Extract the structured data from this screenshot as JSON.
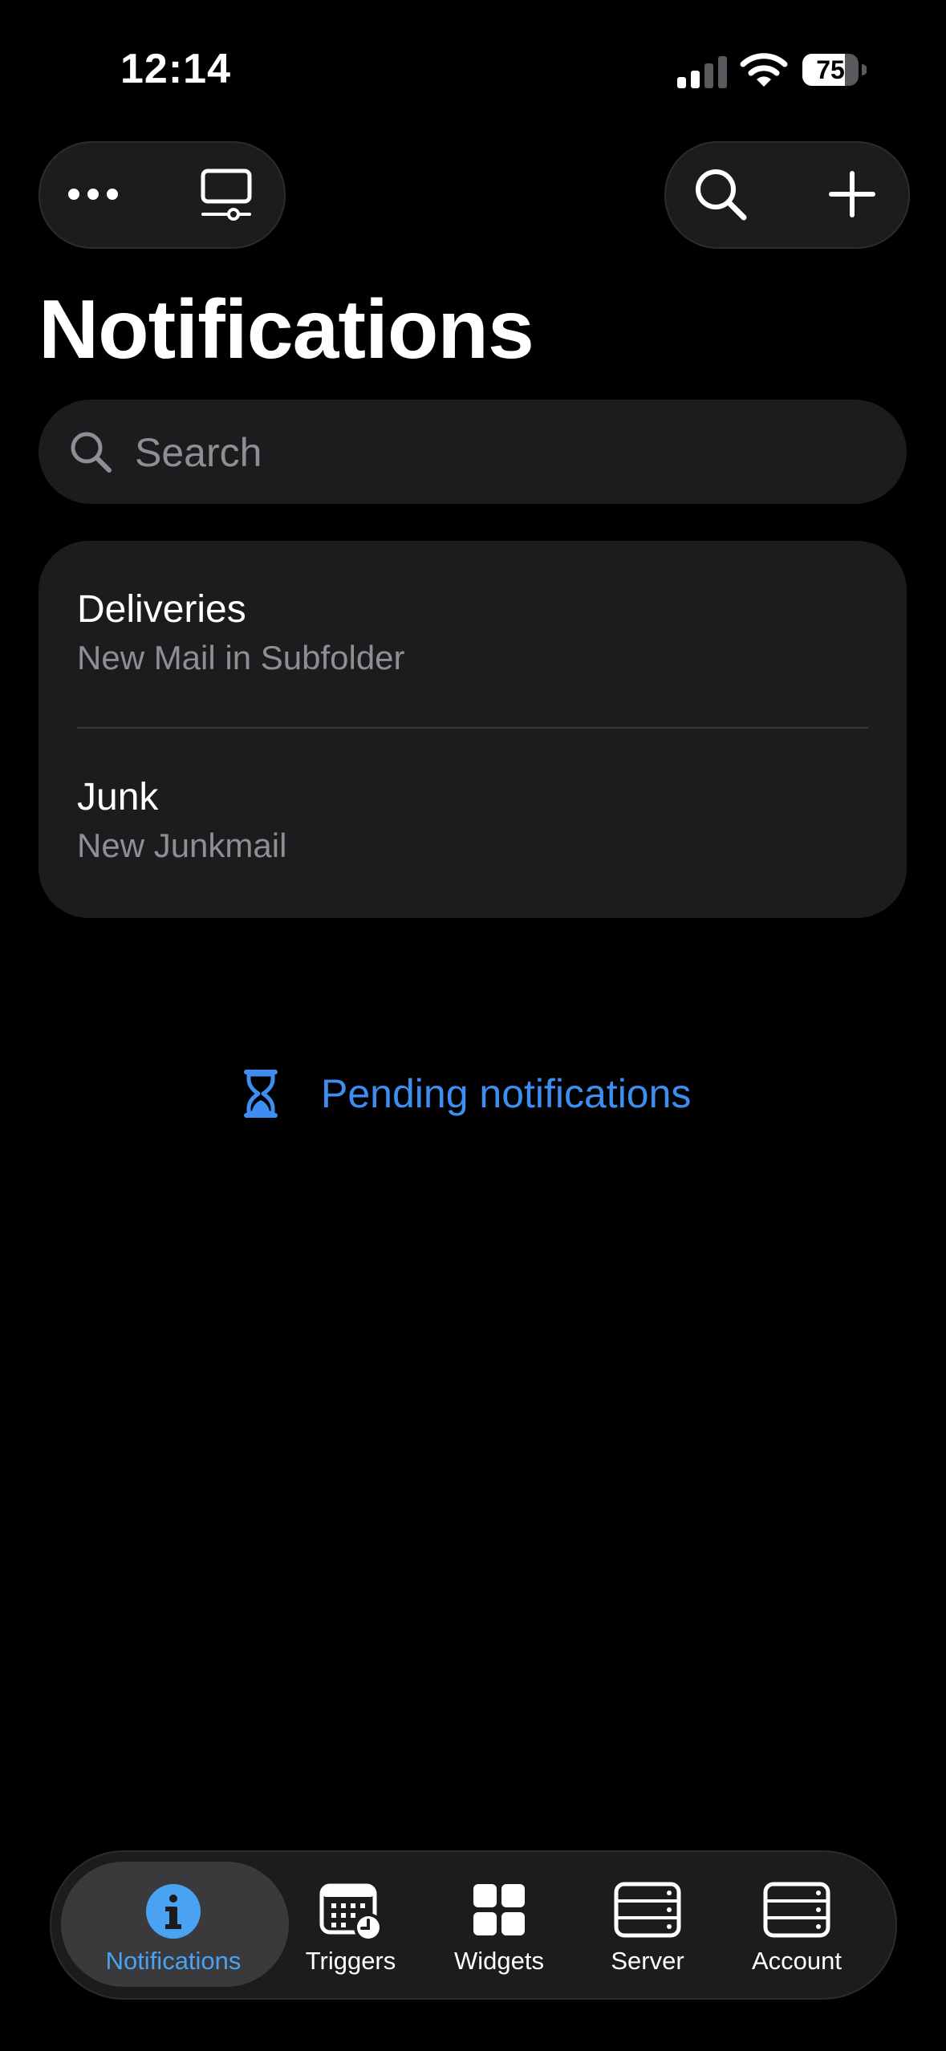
{
  "status_bar": {
    "time": "12:14",
    "battery": "75"
  },
  "toolbar": {
    "more_icon": "ellipsis-icon",
    "server_icon": "desktop-icon",
    "search_icon": "magnifier-icon",
    "add_icon": "plus-icon"
  },
  "page": {
    "title": "Notifications"
  },
  "search": {
    "placeholder": "Search",
    "value": ""
  },
  "notifications": [
    {
      "title": "Deliveries",
      "subtitle": "New Mail in Subfolder"
    },
    {
      "title": "Junk",
      "subtitle": "New Junkmail"
    }
  ],
  "pending": {
    "label": "Pending notifications",
    "icon": "hourglass-icon"
  },
  "tab_bar": {
    "tabs": [
      {
        "label": "Notifications",
        "icon": "info-icon",
        "active": true
      },
      {
        "label": "Triggers",
        "icon": "calendar-clock-icon",
        "active": false
      },
      {
        "label": "Widgets",
        "icon": "grid-icon",
        "active": false
      },
      {
        "label": "Server",
        "icon": "server-icon",
        "active": false
      },
      {
        "label": "Account",
        "icon": "server-icon",
        "active": false
      }
    ]
  },
  "colors": {
    "background": "#000000",
    "surface": "#1c1c1e",
    "accent": "#3d8ef0",
    "secondary_text": "#8e8e93"
  }
}
